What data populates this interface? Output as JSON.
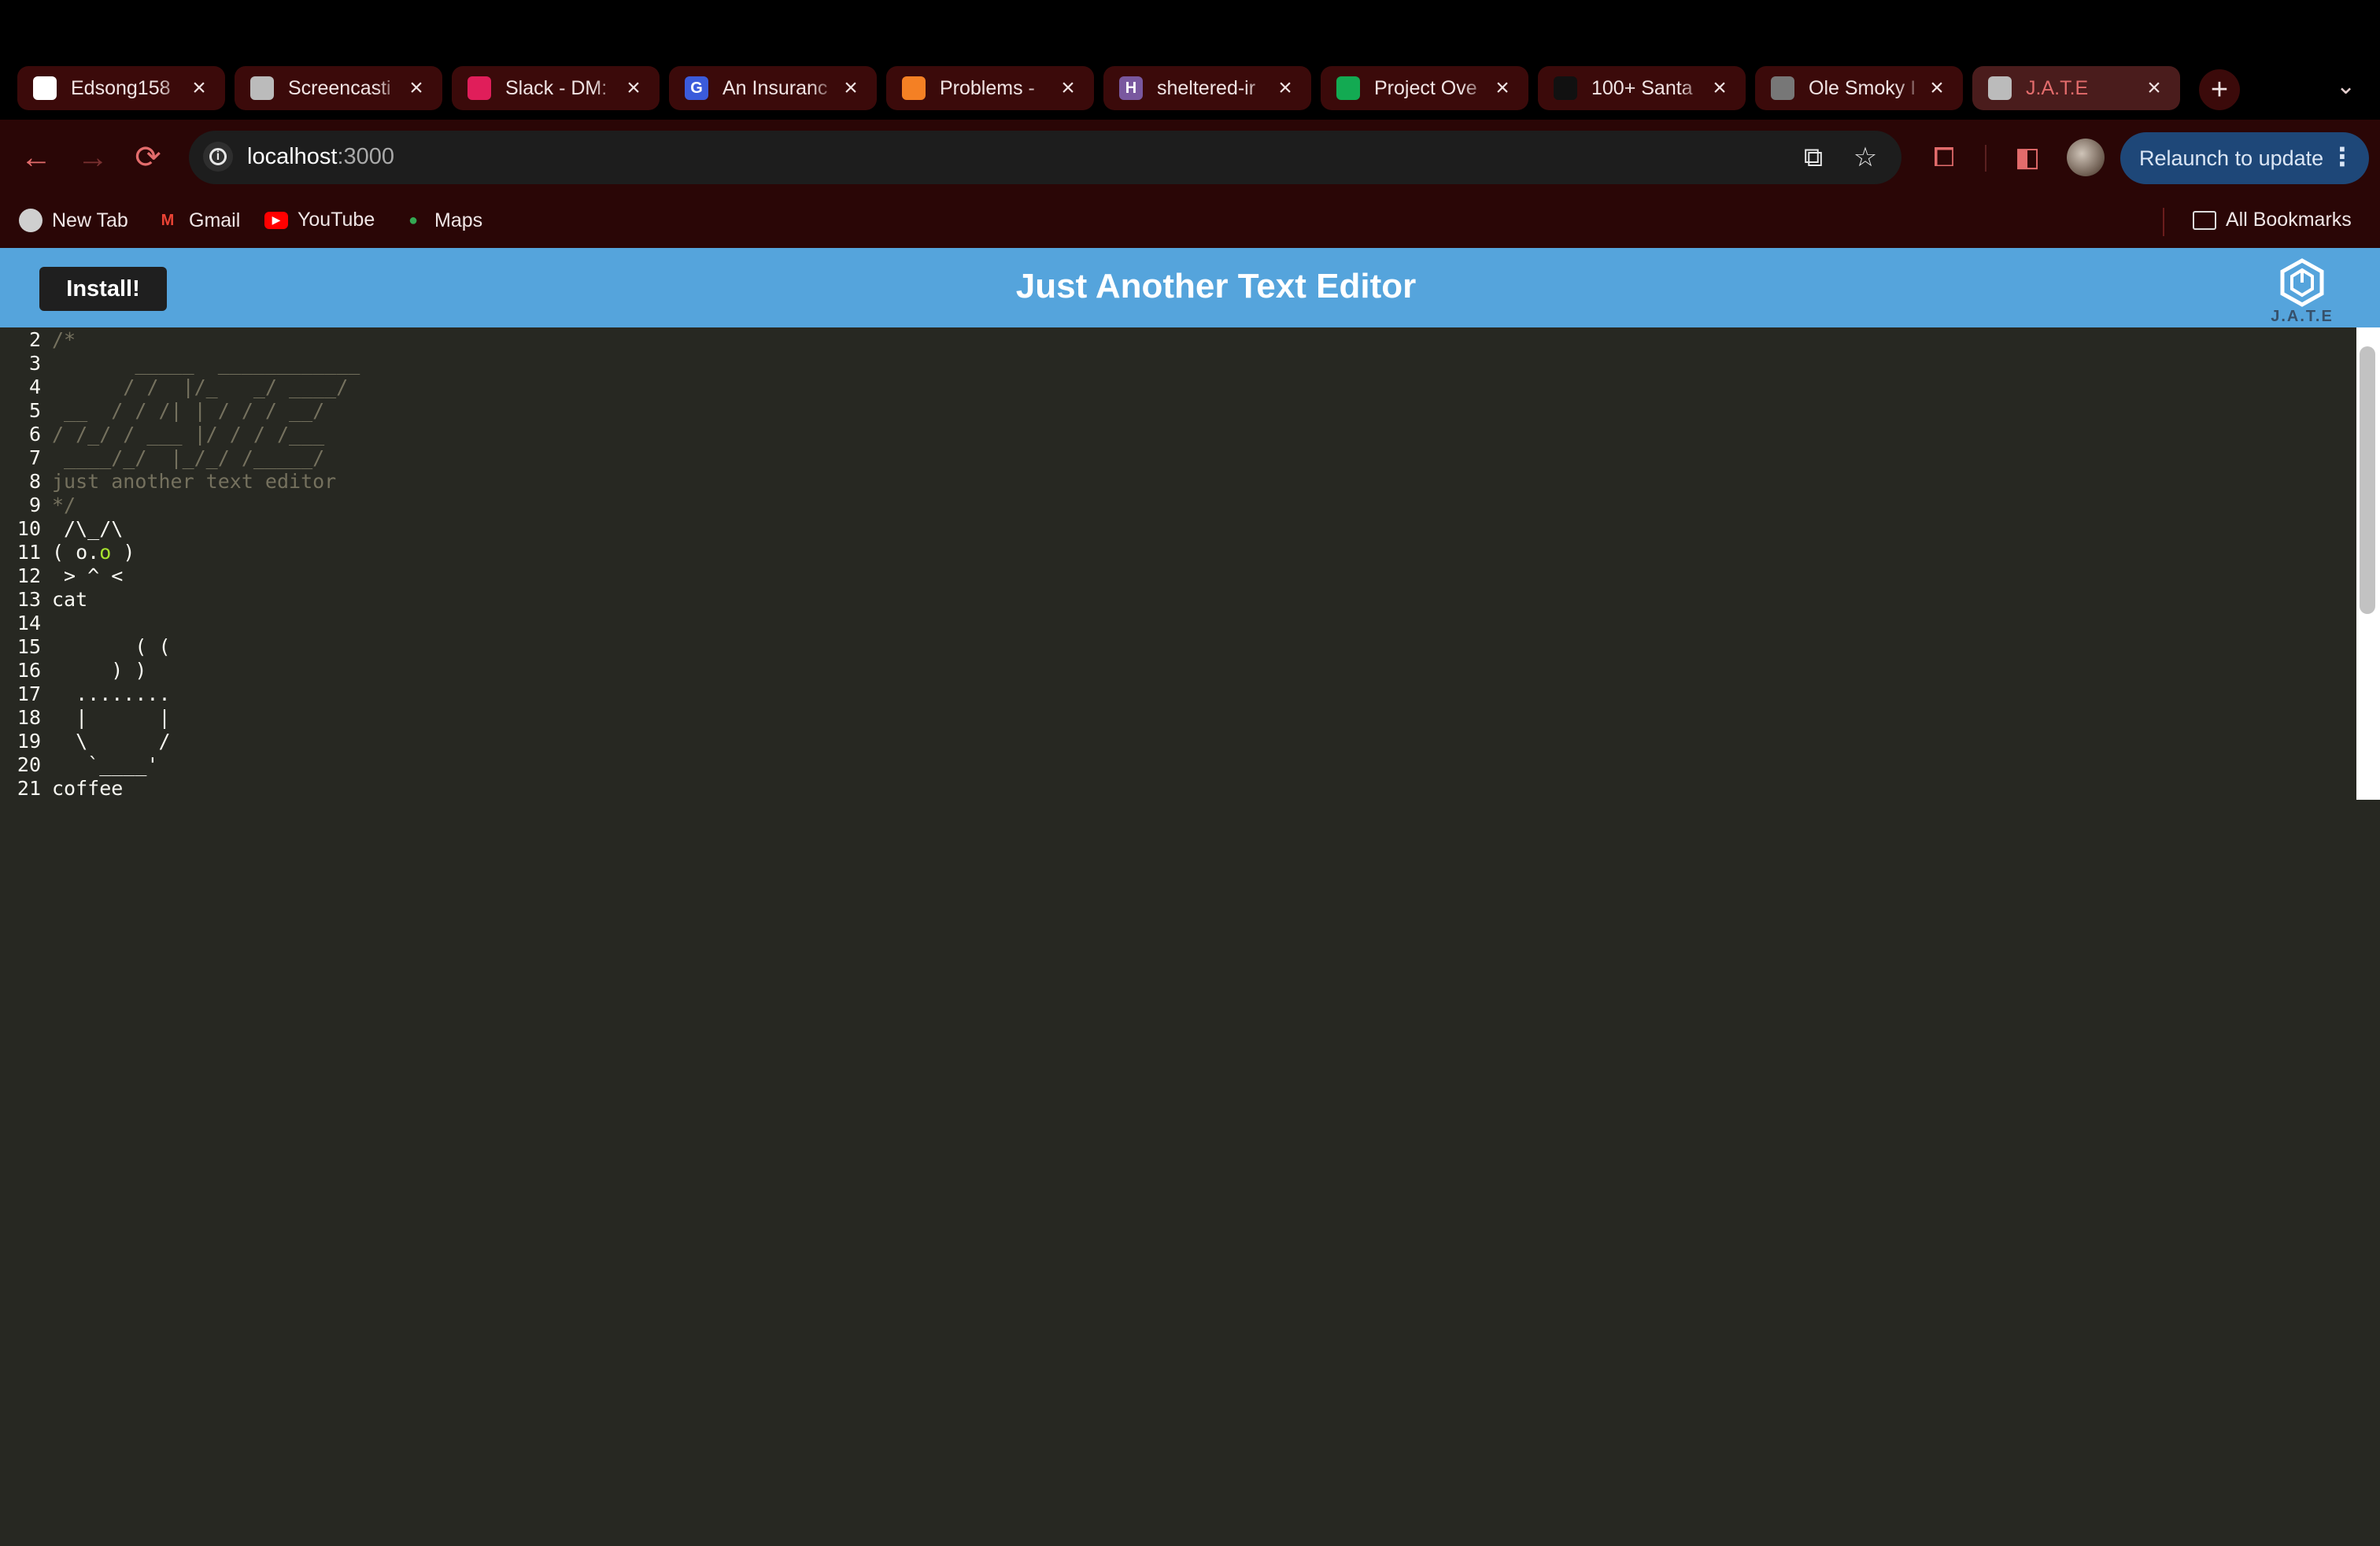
{
  "browser": {
    "tabs": [
      {
        "title": "Edsong158",
        "icon": "github-icon",
        "fav_color": "#ffffff",
        "fav_text": ""
      },
      {
        "title": "Screencasti",
        "icon": "globe-icon",
        "fav_color": "#bbbbbb",
        "fav_text": ""
      },
      {
        "title": "Slack - DM:",
        "icon": "slack-icon",
        "fav_color": "#e01e5a",
        "fav_text": ""
      },
      {
        "title": "An Insuranc",
        "icon": "g-app-icon",
        "fav_color": "#3b5bdb",
        "fav_text": "G"
      },
      {
        "title": "Problems - ",
        "icon": "stackoverflow-icon",
        "fav_color": "#f48024",
        "fav_text": ""
      },
      {
        "title": "sheltered-ir",
        "icon": "heroku-icon",
        "fav_color": "#79589f",
        "fav_text": "H"
      },
      {
        "title": "Project Ove",
        "icon": "mongodb-leaf-icon",
        "fav_color": "#13aa52",
        "fav_text": ""
      },
      {
        "title": "100+ Santa",
        "icon": "unsplash-icon",
        "fav_color": "#111111",
        "fav_text": ""
      },
      {
        "title": "Ole Smoky I",
        "icon": "ole-smoky-icon",
        "fav_color": "#777777",
        "fav_text": ""
      },
      {
        "title": "J.A.T.E",
        "icon": "globe-icon",
        "fav_color": "#bbbbbb",
        "fav_text": "",
        "active": true
      }
    ],
    "url": {
      "host": "localhost",
      "port": ":3000"
    },
    "relaunch_label": "Relaunch to update",
    "bookmarks": [
      {
        "label": "New Tab",
        "icon": "globe-icon"
      },
      {
        "label": "Gmail",
        "icon": "gmail-icon"
      },
      {
        "label": "YouTube",
        "icon": "youtube-icon"
      },
      {
        "label": "Maps",
        "icon": "maps-pin-icon"
      }
    ],
    "all_bookmarks_label": "All Bookmarks",
    "accent_color": "#e36c6c"
  },
  "app": {
    "install_label": "Install!",
    "title": "Just Another Text Editor",
    "logo_text": "J.A.T.E",
    "header_color": "#55a4dc"
  },
  "editor": {
    "lines": [
      {
        "n": "2",
        "text": "/*",
        "comment": true
      },
      {
        "n": "3",
        "text": "       _____  ____________",
        "comment": true
      },
      {
        "n": "4",
        "text": "      / /  |/_   _/ ____/",
        "comment": true
      },
      {
        "n": "5",
        "text": " __  / / /| | / / / __/",
        "comment": true
      },
      {
        "n": "6",
        "text": "/ /_/ / ___ |/ / / /___",
        "comment": true
      },
      {
        "n": "7",
        "text": " ____/_/  |_/_/ /_____/",
        "comment": true
      },
      {
        "n": "8",
        "text": "just another text editor",
        "comment": true
      },
      {
        "n": "9",
        "text": "*/",
        "comment": true
      },
      {
        "n": "10",
        "text": " /\\_/\\",
        "comment": false
      },
      {
        "n": "11",
        "text": "( o.",
        "accent": "o",
        "tail": " )",
        "comment": false
      },
      {
        "n": "12",
        "text": " > ^ <",
        "comment": false
      },
      {
        "n": "13",
        "text": "cat",
        "comment": false
      },
      {
        "n": "14",
        "text": "",
        "comment": false
      },
      {
        "n": "15",
        "text": "       ( (",
        "comment": false
      },
      {
        "n": "16",
        "text": "     ) )",
        "comment": false
      },
      {
        "n": "17",
        "text": "  ........",
        "comment": false
      },
      {
        "n": "18",
        "text": "  |      |",
        "comment": false
      },
      {
        "n": "19",
        "text": "  \\      /",
        "comment": false
      },
      {
        "n": "20",
        "text": "   `____'",
        "comment": false
      },
      {
        "n": "21",
        "text": "coffee",
        "comment": false
      }
    ]
  }
}
